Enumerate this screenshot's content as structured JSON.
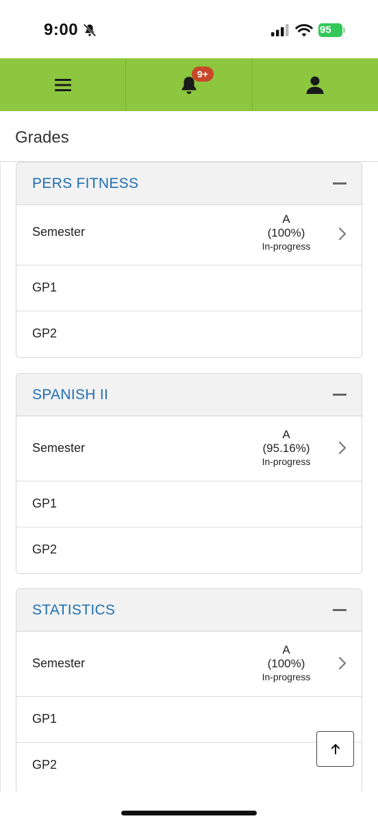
{
  "status_bar": {
    "time": "9:00",
    "battery": "95",
    "battery_color": "#34c759"
  },
  "nav": {
    "menu_icon": "menu-icon",
    "notifications_icon": "bell-icon",
    "notifications_badge": "9+",
    "profile_icon": "user-icon",
    "bar_color": "#8dc63f"
  },
  "page": {
    "title": "Grades"
  },
  "courses": [
    {
      "name": "PERS FITNESS",
      "semester": {
        "label": "Semester",
        "letter": "A",
        "percent": "(100%)",
        "status": "In-progress"
      },
      "periods": [
        {
          "label": "GP1"
        },
        {
          "label": "GP2"
        }
      ]
    },
    {
      "name": "SPANISH II",
      "semester": {
        "label": "Semester",
        "letter": "A",
        "percent": "(95.16%)",
        "status": "In-progress"
      },
      "periods": [
        {
          "label": "GP1"
        },
        {
          "label": "GP2"
        }
      ]
    },
    {
      "name": "STATISTICS",
      "semester": {
        "label": "Semester",
        "letter": "A",
        "percent": "(100%)",
        "status": "In-progress"
      },
      "periods": [
        {
          "label": "GP1"
        },
        {
          "label": "GP2"
        }
      ]
    }
  ],
  "accent_color": "#1f6fb2",
  "scroll_top_icon": "arrow-up-icon"
}
